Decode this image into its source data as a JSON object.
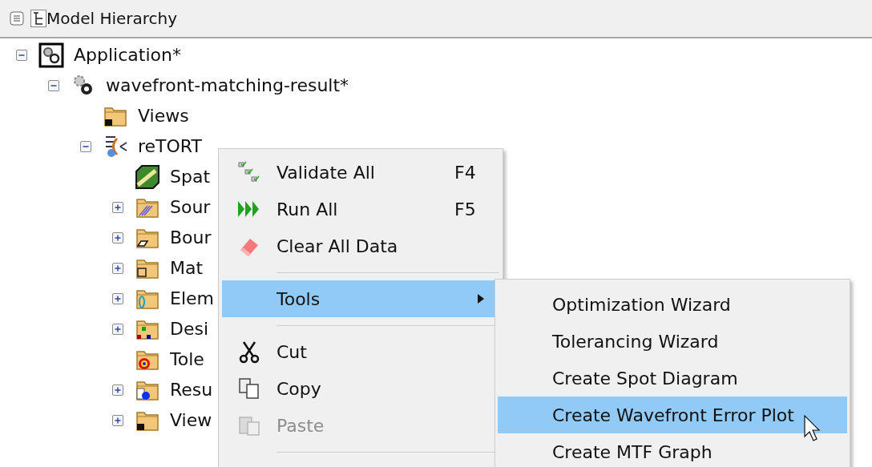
{
  "panel": {
    "title": "Model Hierarchy"
  },
  "tree": [
    {
      "label": "Application*",
      "kind": "application",
      "expanded": true,
      "children": [
        {
          "label": "wavefront-matching-result*",
          "kind": "gears",
          "expanded": true,
          "children": [
            {
              "label": "Views",
              "kind": "folder-views"
            },
            {
              "label": "reTORT",
              "kind": "tool",
              "expanded": true,
              "children": [
                {
                  "label": "Spat",
                  "kind": "cube"
                },
                {
                  "label": "Sour",
                  "kind": "folder-source",
                  "expanded": false
                },
                {
                  "label": "Bour",
                  "kind": "folder-boundary",
                  "expanded": false
                },
                {
                  "label": "Mat",
                  "kind": "folder-material",
                  "expanded": false
                },
                {
                  "label": "Elem",
                  "kind": "folder-element",
                  "expanded": false
                },
                {
                  "label": "Desi",
                  "kind": "folder-design",
                  "expanded": false
                },
                {
                  "label": "Tole",
                  "kind": "folder-target"
                },
                {
                  "label": "Resu",
                  "kind": "folder-results",
                  "expanded": false
                },
                {
                  "label": "View",
                  "kind": "folder-views",
                  "expanded": false
                }
              ]
            }
          ]
        }
      ]
    }
  ],
  "context_menu": [
    {
      "kind": "validate",
      "label": "Validate All",
      "shortcut": "F4",
      "disabled": false,
      "selected": false
    },
    {
      "kind": "run",
      "label": "Run All",
      "shortcut": "F5",
      "disabled": false,
      "selected": false
    },
    {
      "kind": "eraser",
      "label": "Clear All Data",
      "disabled": false,
      "selected": false
    },
    {
      "kind": "separator"
    },
    {
      "kind": "submenu",
      "label": "Tools",
      "disabled": false,
      "selected": true
    },
    {
      "kind": "separator"
    },
    {
      "kind": "scissors",
      "label": "Cut",
      "disabled": false,
      "selected": false
    },
    {
      "kind": "copy",
      "label": "Copy",
      "disabled": false,
      "selected": false
    },
    {
      "kind": "paste",
      "label": "Paste",
      "disabled": true,
      "selected": false
    },
    {
      "kind": "separator"
    }
  ],
  "submenu": [
    {
      "label": "Optimization Wizard",
      "selected": false
    },
    {
      "label": "Tolerancing Wizard",
      "selected": false
    },
    {
      "label": "Create Spot Diagram",
      "selected": false
    },
    {
      "label": "Create Wavefront Error Plot",
      "selected": true
    },
    {
      "label": "Create MTF Graph",
      "selected": false
    }
  ]
}
